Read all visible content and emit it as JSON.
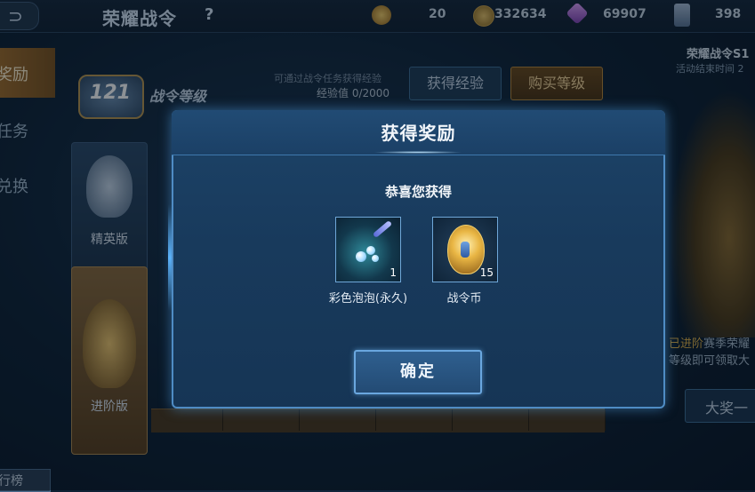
{
  "topbar": {
    "title": "荣耀战令",
    "help": "?",
    "resources": [
      {
        "name": "battlepass-coin",
        "value": "20",
        "icon": "battlepass-coin-icon",
        "color": "#d9a23a"
      },
      {
        "name": "gold",
        "value": "332634",
        "icon": "gold-coin-icon",
        "color": "#c9a04a"
      },
      {
        "name": "gem",
        "value": "69907",
        "icon": "diamond-icon",
        "color": "#b35fd8"
      },
      {
        "name": "ticket",
        "value": "398",
        "icon": "voucher-icon",
        "color": "#7d9cc0"
      }
    ]
  },
  "sidebar": {
    "tabs": [
      {
        "label": "奖励",
        "active": true
      },
      {
        "label": "任务",
        "active": false
      },
      {
        "label": "兑换",
        "active": false
      }
    ],
    "rank": "行榜"
  },
  "level": {
    "number": "121",
    "label": "战令等级",
    "hint": "可通过战令任务获得经验",
    "exp": "经验值 0/2000",
    "get_exp": "获得经验",
    "buy_level": "购买等级"
  },
  "tiers": {
    "elite": "精英版",
    "advanced": "进阶版"
  },
  "right_panel": {
    "title": "荣耀战令S1",
    "time": "活动结束时间 2",
    "desc_highlight": "已进阶",
    "desc_rest": "赛季荣耀",
    "desc2": "等级即可领取大",
    "grand_prize": "大奖一"
  },
  "modal": {
    "title": "获得奖励",
    "subtitle": "恭喜您获得",
    "items": [
      {
        "name": "彩色泡泡(永久)",
        "count": "1",
        "icon": "bubble-effect-icon"
      },
      {
        "name": "战令币",
        "count": "15",
        "icon": "battlepass-coin-icon"
      }
    ],
    "confirm": "确定"
  },
  "colors": {
    "accent_blue": "#4f8cc4",
    "gold": "#d9a23a",
    "background": "#0f2236"
  }
}
